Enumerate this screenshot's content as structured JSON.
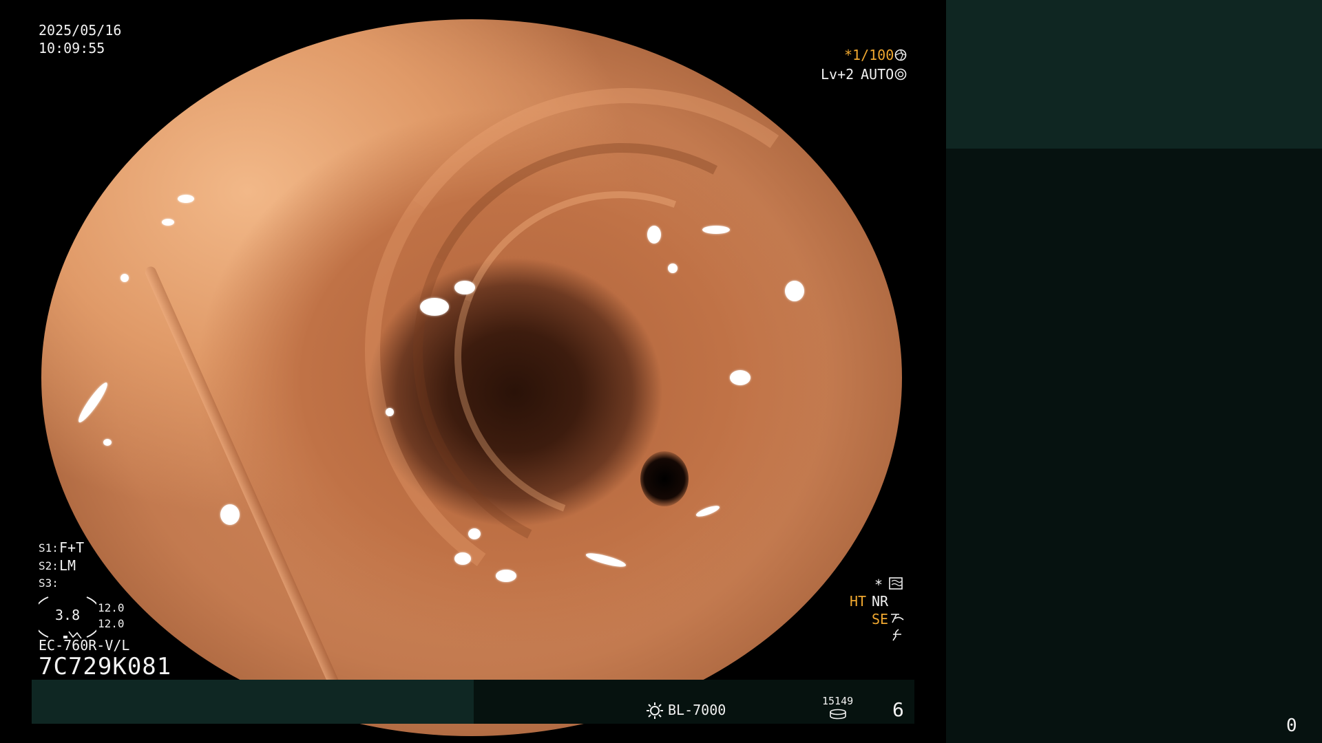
{
  "datetime": {
    "date": "2025/05/16",
    "time": "10:09:55"
  },
  "exposure": {
    "shutter": "*1/100",
    "level": "Lv+2",
    "mode": "AUTO"
  },
  "settings": {
    "s1_label": "S1:",
    "s1_value": "F+T",
    "s2_label": "S2:",
    "s2_value": "LM",
    "s3_label": "S3:",
    "s3_value": ""
  },
  "gauge": {
    "value": "3.8",
    "upper": "12.0",
    "lower": "12.0"
  },
  "scope": {
    "model": "EC-760R-V/L",
    "serial": "7C729K081"
  },
  "enhancement": {
    "star": "*",
    "ht": "HT",
    "nr": "NR",
    "se": "SE"
  },
  "light_source": {
    "name": "BL-7000",
    "count": "15149",
    "level": "6"
  },
  "panel": {
    "counter": "0"
  },
  "icons": {
    "shutter_icon": "aperture-icon",
    "auto_icon": "iris-icon",
    "enhance_icon": "image-mode-icon",
    "se_icon": "structure-enhance-icon",
    "lamp_icon": "lamp-icon",
    "hours_icon": "lamp-hours-icon"
  },
  "colors": {
    "accent": "#f0a830",
    "panel_top": "#0f2622",
    "panel_bottom": "#061210",
    "bar_teal": "#0f2723"
  }
}
